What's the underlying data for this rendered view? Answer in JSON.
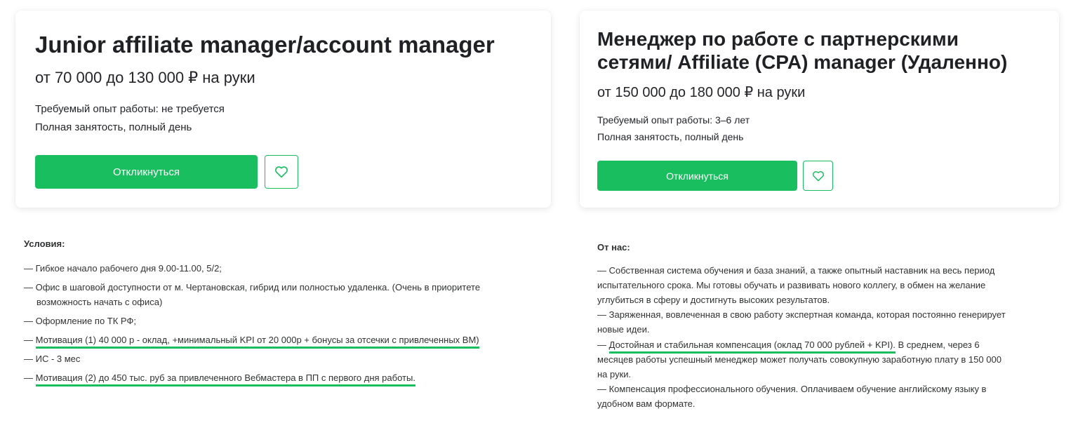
{
  "left": {
    "title": "Junior affiliate manager/account manager",
    "salary": "от 70 000 до 130 000 ₽ на руки",
    "experience": "Требуемый опыт работы: не требуется",
    "employment": "Полная занятость, полный день",
    "apply_label": "Откликнуться",
    "conditions_title": "Условия:",
    "conditions": [
      "— Гибкое начало рабочего дня 9.00-11.00, 5/2;",
      "— Офис в шаговой доступности от м. Чертановская, гибрид или полностью удаленка. (Очень в приоритете",
      "возможность начать с офиса)",
      "— Оформление по ТК РФ;",
      "Мотивация (1) 40 000 р - оклад, +минимальный KPI от 20 000р + бонусы за отсечки с привлеченных ВМ)",
      "— ИС - 3 мес",
      "Мотивация (2) до 450 тыс. руб за привлеченного Вебмастера в ПП с первого дня работы."
    ],
    "dash": "— "
  },
  "right": {
    "title_line1": "Менеджер по работе с партнерскими",
    "title_line2": "сетями/ Affiliate (CPA) manager (Удаленно)",
    "salary": "от 150 000 до 180 000 ₽ на руки",
    "experience": "Требуемый опыт работы: 3–6 лет",
    "employment": "Полная занятость, полный день",
    "apply_label": "Откликнуться",
    "offer_title": "От нас:",
    "offer": [
      "— Собственная система обучения и база знаний, а также опытный наставник на весь период",
      "испытательного срока. Мы готовы обучать и развивать нового коллегу, в обмен на желание",
      "углубиться в сферу и достигнуть высоких результатов.",
      "— Заряженная, вовлеченная в свою работу экспертная команда, которая постоянно генерирует",
      "новые идеи.",
      "Достойная и стабильная компенсация (оклад 70 000 рублей + KPI).",
      " В среднем, через 6",
      "месяцев работы успешный менеджер может получать совокупную заработную плату в 150 000",
      "на руки.",
      "— Компенсация профессионального обучения. Оплачиваем обучение английскому языку в",
      "удобном вам формате."
    ],
    "dash": "— "
  },
  "colors": {
    "accent": "#19be5f",
    "text": "#232529"
  },
  "icons": {
    "favorite": "heart-outline-icon"
  }
}
